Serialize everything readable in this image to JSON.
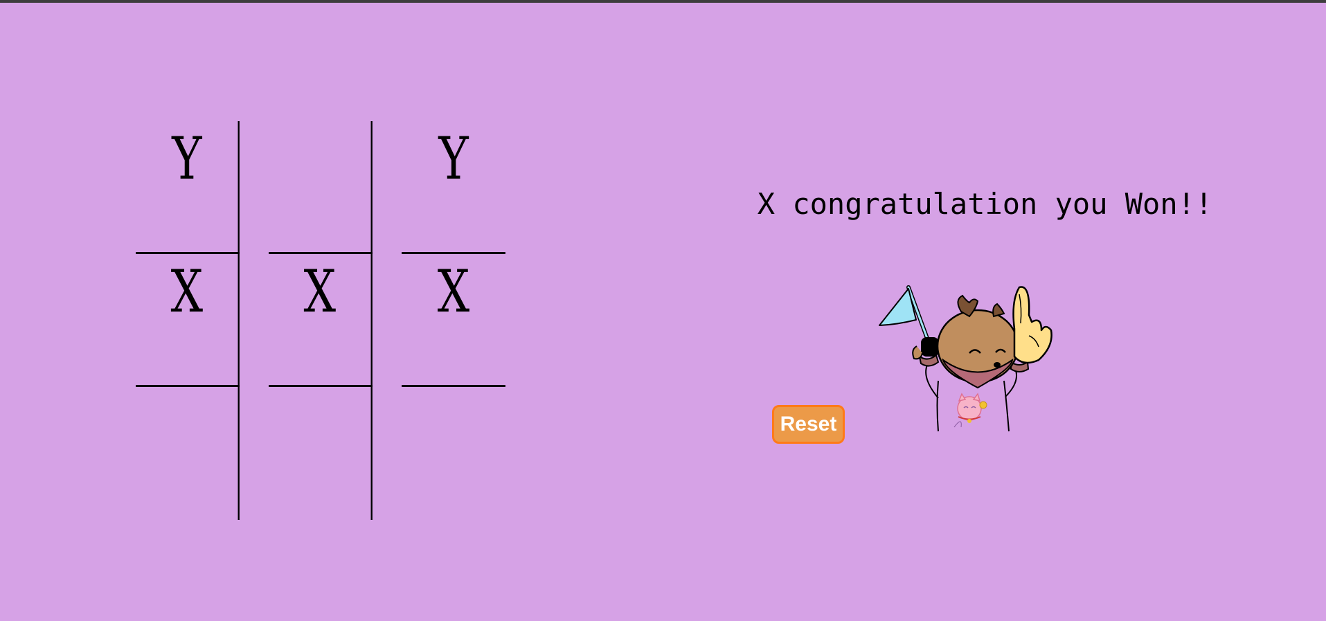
{
  "board": {
    "cells": [
      "Y",
      "",
      "Y",
      "X",
      "X",
      "X",
      "",
      "",
      ""
    ]
  },
  "status": {
    "message": "X congratulation you Won!!"
  },
  "controls": {
    "reset_label": "Reset"
  },
  "illustration": {
    "icon": "celebrating-deer-mascot-icon"
  },
  "colors": {
    "background": "#d6a2e6",
    "reset_button": "#ec9a48",
    "reset_border": "#ff7a18"
  }
}
